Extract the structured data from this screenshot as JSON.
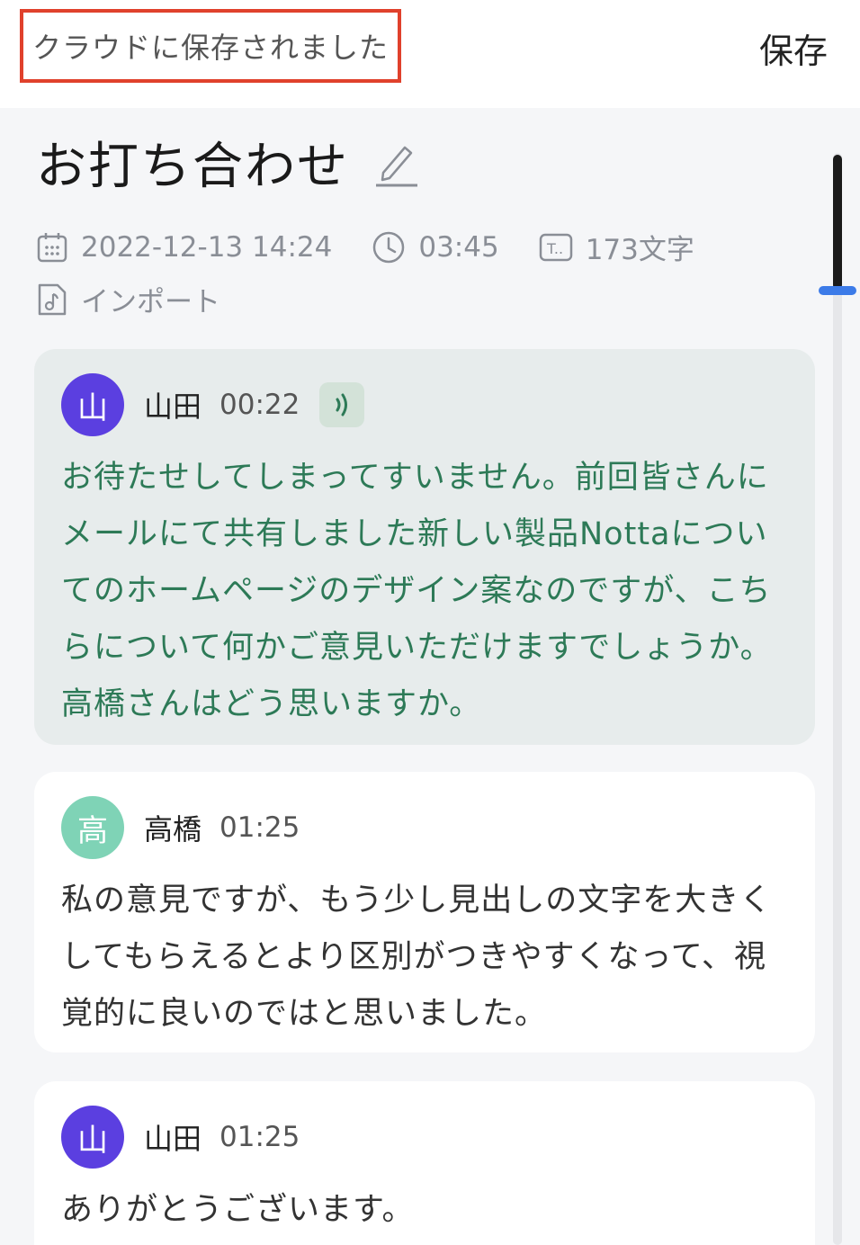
{
  "header": {
    "status_text": "クラウドに保存されました",
    "save_label": "保存"
  },
  "note": {
    "title": "お打ち合わせ",
    "date": "2022-12-13 14:24",
    "duration": "03:45",
    "char_count": "173文字",
    "source": "インポート"
  },
  "transcript": [
    {
      "avatar": "山",
      "speaker": "山田",
      "time": "00:22",
      "active": true,
      "text": "お待たせしてしまってすいません。前回皆さんにメールにて共有しました新しい製品Nottaについてのホームページのデザイン案なのですが、こちらについて何かご意見いただけますでしょうか。高橋さんはどう思いますか。"
    },
    {
      "avatar": "高",
      "speaker": "高橋",
      "time": "01:25",
      "active": false,
      "text": "私の意見ですが、もう少し見出しの文字を大きくしてもらえるとより区別がつきやすくなって、視覚的に良いのではと思いました。"
    },
    {
      "avatar": "山",
      "speaker": "山田",
      "time": "01:25",
      "active": false,
      "text": "ありがとうございます。"
    }
  ],
  "colors": {
    "avatar_yamada": "#5b3fe0",
    "avatar_takahashi": "#7fd3b6",
    "active_text": "#2d7a57",
    "status_border": "#e0412c",
    "scroll_marker": "#3c7be8"
  },
  "icons": [
    "pencil-icon",
    "calendar-icon",
    "clock-icon",
    "text-count-icon",
    "audio-file-icon",
    "sound-wave-icon"
  ]
}
